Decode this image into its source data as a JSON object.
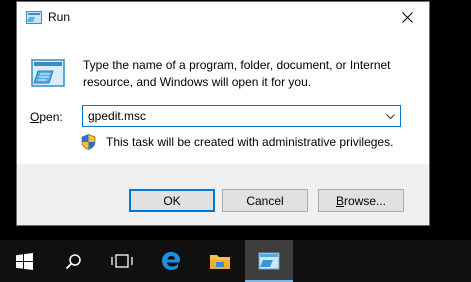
{
  "window": {
    "title": "Run",
    "close_label": "Close"
  },
  "content": {
    "description": "Type the name of a program, folder, document, or Internet resource, and Windows will open it for you.",
    "open_label": "Open:",
    "open_value": "gpedit.msc",
    "admin_notice": "This task will be created with administrative privileges."
  },
  "buttons": {
    "ok": "OK",
    "cancel": "Cancel",
    "browse": "Browse..."
  },
  "taskbar": {
    "items": [
      {
        "icon": "windows-start-icon"
      },
      {
        "icon": "search-icon"
      },
      {
        "icon": "task-view-icon"
      },
      {
        "icon": "edge-browser-icon"
      },
      {
        "icon": "file-explorer-icon"
      },
      {
        "icon": "run-app-icon",
        "active": true
      }
    ]
  },
  "colors": {
    "accent": "#0078d7",
    "taskbar": "#101010",
    "footer": "#f0f0f0"
  }
}
